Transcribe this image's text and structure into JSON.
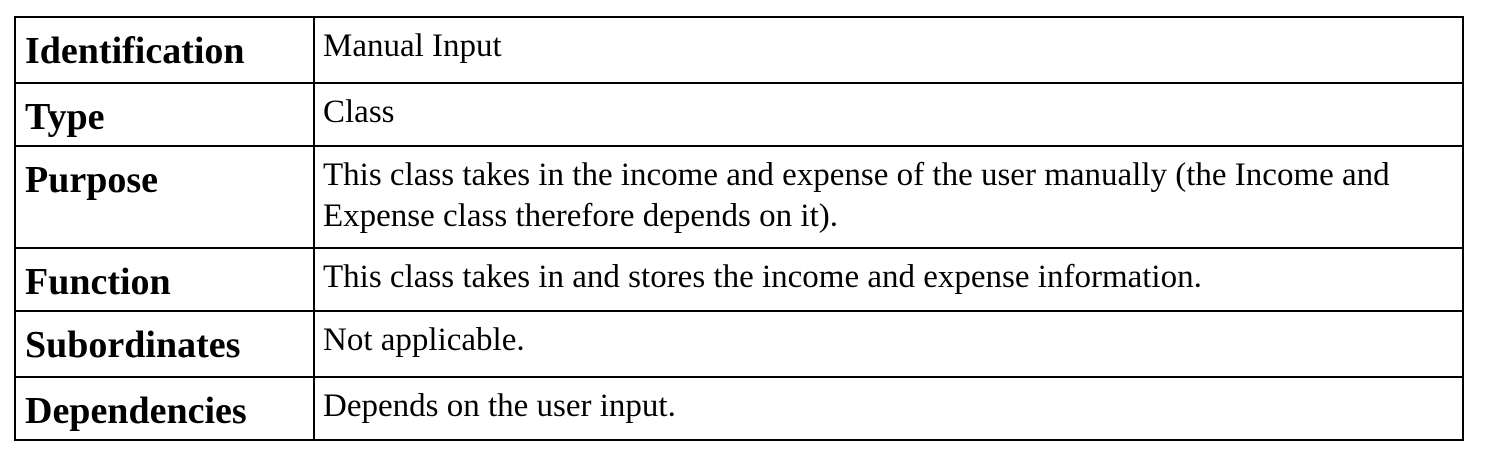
{
  "rows": [
    {
      "label": "Identification",
      "value": "Manual Input"
    },
    {
      "label": "Type",
      "value": "Class"
    },
    {
      "label": "Purpose",
      "value": "This class takes in the income and expense of the user manually (the Income and Expense class therefore depends on it)."
    },
    {
      "label": "Function",
      "value": "This class takes in and stores the income and expense information."
    },
    {
      "label": "Subordinates",
      "value": "Not applicable."
    },
    {
      "label": "Dependencies",
      "value": "Depends on the user input."
    }
  ],
  "colors": {
    "border": "#000000",
    "text": "#000000",
    "background": "#ffffff"
  }
}
